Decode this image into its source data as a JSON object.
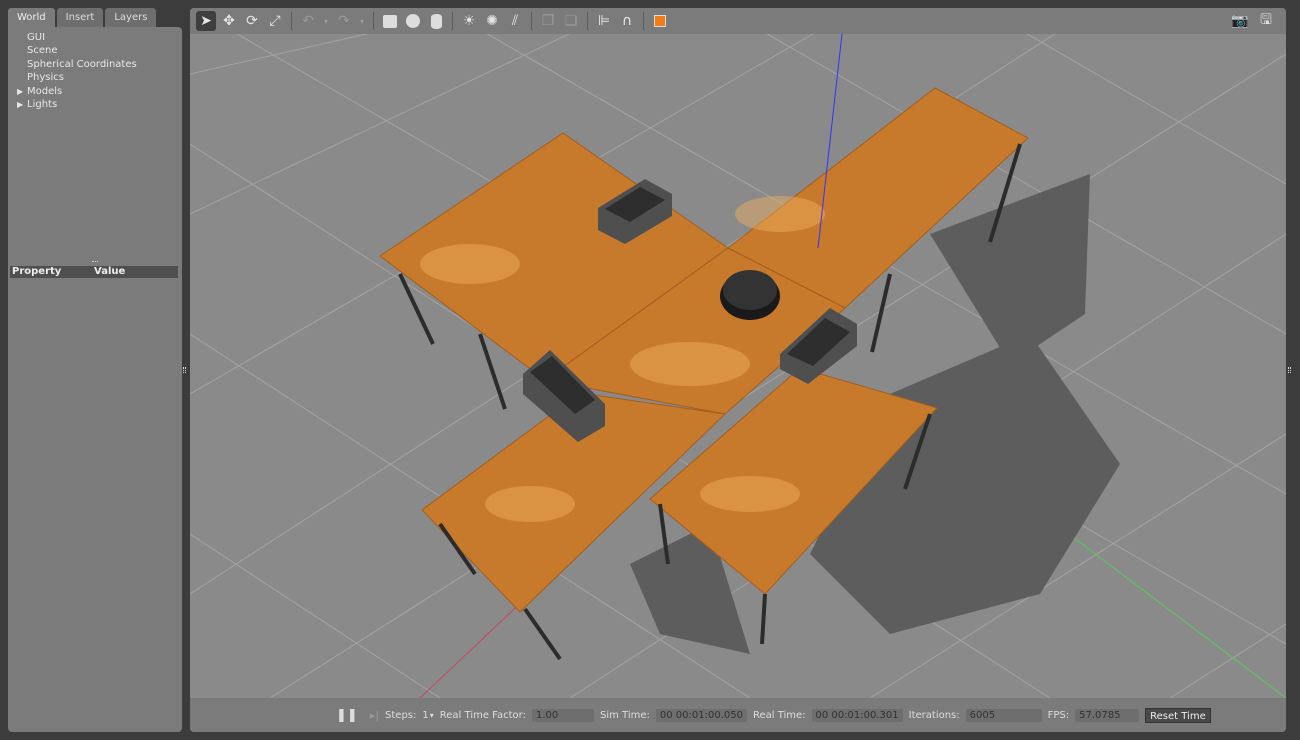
{
  "tabs": [
    {
      "label": "World"
    },
    {
      "label": "Insert"
    },
    {
      "label": "Layers"
    }
  ],
  "tree": [
    {
      "label": "GUI",
      "expandable": false
    },
    {
      "label": "Scene",
      "expandable": false
    },
    {
      "label": "Spherical Coordinates",
      "expandable": false
    },
    {
      "label": "Physics",
      "expandable": false
    },
    {
      "label": "Models",
      "expandable": true
    },
    {
      "label": "Lights",
      "expandable": true
    }
  ],
  "property_table": {
    "col_property": "Property",
    "col_value": "Value"
  },
  "toolbar": {
    "icons": [
      "select-arrow",
      "translate",
      "rotate",
      "scale",
      "undo",
      "redo",
      "box",
      "sphere",
      "cylinder",
      "point-light",
      "spot-light",
      "directional-light",
      "copy",
      "paste",
      "align",
      "snap",
      "view-angle"
    ],
    "accent": "#f07d17"
  },
  "bottom": {
    "steps_label": "Steps:",
    "steps_value": "1",
    "rtf_label": "Real Time Factor:",
    "rtf_value": "1.00",
    "sim_label": "Sim Time:",
    "sim_value": "00 00:01:00.050",
    "real_label": "Real Time:",
    "real_value": "00 00:01:00.301",
    "iter_label": "Iterations:",
    "iter_value": "6005",
    "fps_label": "FPS:",
    "fps_value": "57.0785",
    "reset_label": "Reset Time"
  }
}
